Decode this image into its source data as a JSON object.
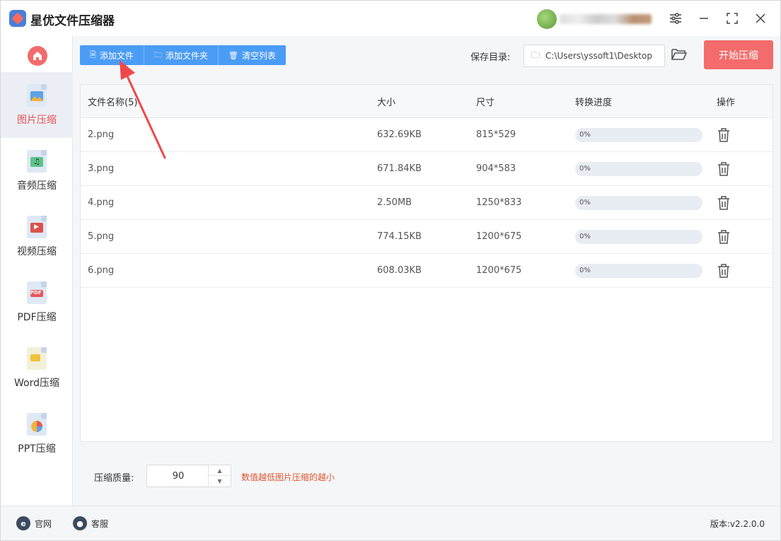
{
  "app": {
    "title": "星优文件压缩器"
  },
  "sidebar": {
    "items": [
      {
        "label": "图片压缩",
        "icon": "image-file-icon",
        "active": true
      },
      {
        "label": "音频压缩",
        "icon": "audio-file-icon"
      },
      {
        "label": "视频压缩",
        "icon": "video-file-icon"
      },
      {
        "label": "PDF压缩",
        "icon": "pdf-file-icon"
      },
      {
        "label": "Word压缩",
        "icon": "word-file-icon"
      },
      {
        "label": "PPT压缩",
        "icon": "ppt-file-icon"
      }
    ],
    "pdf_badge": "PDF"
  },
  "toolbar": {
    "add_file": "添加文件",
    "add_folder": "添加文件夹",
    "clear_list": "清空列表",
    "save_dir_label": "保存目录:",
    "save_dir_value": "C:\\Users\\yssoft1\\Desktop",
    "start": "开始压缩"
  },
  "table": {
    "headers": {
      "name": "文件名称(5)",
      "size": "大小",
      "dims": "尺寸",
      "progress": "转换进度",
      "action": "操作"
    },
    "rows": [
      {
        "name": "2.png",
        "size": "632.69KB",
        "dims": "815*529",
        "progress": "0%",
        "progress_value": 0
      },
      {
        "name": "3.png",
        "size": "671.84KB",
        "dims": "904*583",
        "progress": "0%",
        "progress_value": 0
      },
      {
        "name": "4.png",
        "size": "2.50MB",
        "dims": "1250*833",
        "progress": "0%",
        "progress_value": 0
      },
      {
        "name": "5.png",
        "size": "774.15KB",
        "dims": "1200*675",
        "progress": "0%",
        "progress_value": 0
      },
      {
        "name": "6.png",
        "size": "608.03KB",
        "dims": "1200*675",
        "progress": "0%",
        "progress_value": 0
      }
    ]
  },
  "quality": {
    "label": "压缩质量:",
    "value": "90",
    "hint": "数值越低图片压缩的越小"
  },
  "statusbar": {
    "website": "官网",
    "support": "客服",
    "version": "版本:v2.2.0.0"
  },
  "colors": {
    "primary": "#4b9cf5",
    "accent": "#f36b6b",
    "hint": "#e0542e"
  }
}
